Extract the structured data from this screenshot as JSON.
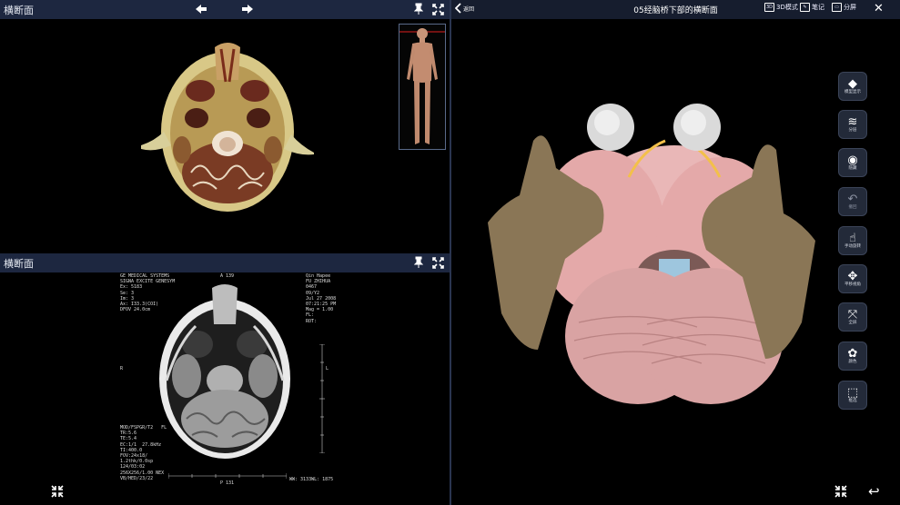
{
  "top_left": {
    "title": "横断面",
    "back_arrow": "arrow-left-icon",
    "forward_arrow": "arrow-right-icon"
  },
  "bottom_left": {
    "title": "横断面",
    "mri": {
      "top_left": "GE MEDICAL SYSTEMS\nSIGNA EXCITE GENESYM\nEx: 5183\nSe: 3\nIm: 3\nAx: I33.3(COI)\nDFOV 24.0cm",
      "top_center": "A 139",
      "top_right": "Qin Hapee\nFU ZHIHUA\n0467\n09/Y2\nJul 27 2008\n07:21:25 PM\nMag = 1.00\nFL:\nROT:",
      "bottom_left": "MOD/FSPGR/T2   FL\nTR:5.6\nTE:5.4\nEC:1/1  27.8kHz\nTI:400.0\nFOV:24x18/\n1.2thk/0.0sp\n124/03:02\n256X256/1.00 NEX\nVB/HED/23/22",
      "bottom_right": "WW: 3133WL: 1875",
      "bottom_center": "P 131",
      "side_left": "R",
      "side_right": "L"
    }
  },
  "right": {
    "back_label": "返回",
    "title": "05经脑桥下部的横断面",
    "top_buttons": [
      {
        "icon": "3d-toggle-icon",
        "label": "3D模式"
      },
      {
        "icon": "note-icon",
        "label": "笔记"
      },
      {
        "icon": "layout-icon",
        "label": "分屏"
      }
    ],
    "tools": [
      {
        "icon": "model-display-icon",
        "label": "模型显示"
      },
      {
        "icon": "layers-icon",
        "label": "分层"
      },
      {
        "icon": "eye-icon",
        "label": "隐藏"
      },
      {
        "icon": "undo-icon",
        "label": "撤回"
      },
      {
        "icon": "touch-rotate-icon",
        "label": "手动旋转"
      },
      {
        "icon": "move-icon",
        "label": "平移视角"
      },
      {
        "icon": "fullscreen-icon",
        "label": "全屏"
      },
      {
        "icon": "palette-icon",
        "label": "颜色"
      },
      {
        "icon": "select-box-icon",
        "label": "框选"
      }
    ]
  }
}
